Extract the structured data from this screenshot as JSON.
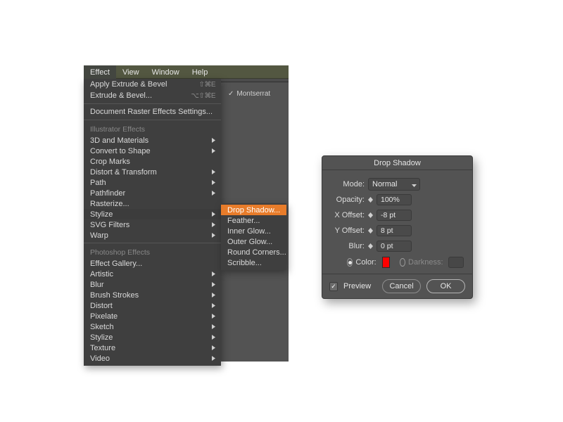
{
  "menubar": {
    "items": [
      "Effect",
      "View",
      "Window",
      "Help"
    ],
    "active_index": 0,
    "font_label": "Montserrat"
  },
  "effect_menu": {
    "apply_last": {
      "label": "Apply Extrude & Bevel",
      "shortcut": "⇧⌘E"
    },
    "last_effect": {
      "label": "Extrude & Bevel...",
      "shortcut": "⌥⇧⌘E"
    },
    "raster_settings": "Document Raster Effects Settings...",
    "section_illustrator": "Illustrator Effects",
    "illustrator_items": [
      {
        "label": "3D and Materials",
        "submenu": true
      },
      {
        "label": "Convert to Shape",
        "submenu": true
      },
      {
        "label": "Crop Marks",
        "submenu": false
      },
      {
        "label": "Distort & Transform",
        "submenu": true
      },
      {
        "label": "Path",
        "submenu": true
      },
      {
        "label": "Pathfinder",
        "submenu": true
      },
      {
        "label": "Rasterize...",
        "submenu": false
      },
      {
        "label": "Stylize",
        "submenu": true
      },
      {
        "label": "SVG Filters",
        "submenu": true
      },
      {
        "label": "Warp",
        "submenu": true
      }
    ],
    "section_photoshop": "Photoshop Effects",
    "photoshop_items": [
      {
        "label": "Effect Gallery...",
        "submenu": false
      },
      {
        "label": "Artistic",
        "submenu": true
      },
      {
        "label": "Blur",
        "submenu": true
      },
      {
        "label": "Brush Strokes",
        "submenu": true
      },
      {
        "label": "Distort",
        "submenu": true
      },
      {
        "label": "Pixelate",
        "submenu": true
      },
      {
        "label": "Sketch",
        "submenu": true
      },
      {
        "label": "Stylize",
        "submenu": true
      },
      {
        "label": "Texture",
        "submenu": true
      },
      {
        "label": "Video",
        "submenu": true
      }
    ]
  },
  "stylize_submenu": {
    "items": [
      "Drop Shadow...",
      "Feather...",
      "Inner Glow...",
      "Outer Glow...",
      "Round Corners...",
      "Scribble..."
    ],
    "selected_index": 0
  },
  "dialog": {
    "title": "Drop Shadow",
    "mode_label": "Mode:",
    "mode_value": "Normal",
    "opacity_label": "Opacity:",
    "opacity_value": "100%",
    "xoffset_label": "X Offset:",
    "xoffset_value": "-8 pt",
    "yoffset_label": "Y Offset:",
    "yoffset_value": "8 pt",
    "blur_label": "Blur:",
    "blur_value": "0 pt",
    "color_label": "Color:",
    "color_value": "#ff0000",
    "darkness_label": "Darkness:",
    "color_selected": true,
    "preview_label": "Preview",
    "preview_checked": true,
    "cancel": "Cancel",
    "ok": "OK"
  }
}
